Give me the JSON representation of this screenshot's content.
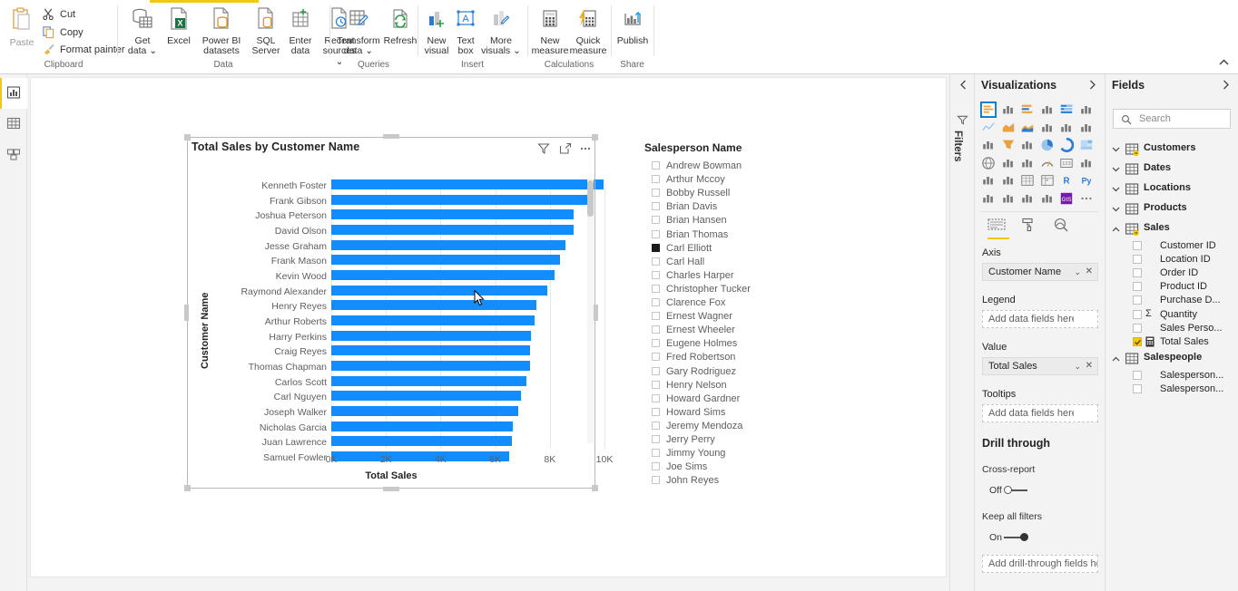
{
  "ribbon": {
    "collapse_icon": "chevron-up-icon",
    "groups": [
      {
        "name": "clipboard",
        "label": "Clipboard",
        "paste_label": "Paste",
        "commands": [
          {
            "label": "Cut",
            "icon": "scissors-icon"
          },
          {
            "label": "Copy",
            "icon": "copy-icon"
          },
          {
            "label": "Format painter",
            "icon": "paintbrush-icon"
          }
        ]
      },
      {
        "name": "data",
        "label": "Data",
        "buttons": [
          {
            "label": "Get\ndata",
            "line1": "Get",
            "line2": "data",
            "caret": true,
            "icon": "get-data-icon"
          },
          {
            "label": "Excel",
            "line1": "Excel",
            "line2": "",
            "caret": false,
            "icon": "excel-icon"
          },
          {
            "label": "Power BI datasets",
            "line1": "Power BI",
            "line2": "datasets",
            "caret": false,
            "icon": "powerbi-datasets-icon"
          },
          {
            "label": "SQL Server",
            "line1": "SQL",
            "line2": "Server",
            "caret": false,
            "icon": "sql-server-icon"
          },
          {
            "label": "Enter data",
            "line1": "Enter",
            "line2": "data",
            "caret": false,
            "icon": "enter-data-icon"
          },
          {
            "label": "Recent sources",
            "line1": "Recent",
            "line2": "sources",
            "caret": true,
            "icon": "recent-sources-icon"
          }
        ]
      },
      {
        "name": "queries",
        "label": "Queries",
        "buttons": [
          {
            "line1": "Transform",
            "line2": "data",
            "caret": true,
            "icon": "transform-data-icon"
          },
          {
            "line1": "Refresh",
            "line2": "",
            "caret": false,
            "icon": "refresh-icon"
          }
        ]
      },
      {
        "name": "insert",
        "label": "Insert",
        "buttons": [
          {
            "line1": "New",
            "line2": "visual",
            "caret": false,
            "icon": "new-visual-icon"
          },
          {
            "line1": "Text",
            "line2": "box",
            "caret": false,
            "icon": "text-box-icon"
          },
          {
            "line1": "More",
            "line2": "visuals",
            "caret": true,
            "icon": "more-visuals-icon"
          }
        ]
      },
      {
        "name": "calculations",
        "label": "Calculations",
        "buttons": [
          {
            "line1": "New",
            "line2": "measure",
            "caret": false,
            "icon": "new-measure-icon"
          },
          {
            "line1": "Quick",
            "line2": "measure",
            "caret": false,
            "icon": "quick-measure-icon"
          }
        ]
      },
      {
        "name": "share",
        "label": "Share",
        "buttons": [
          {
            "line1": "Publish",
            "line2": "",
            "caret": false,
            "icon": "publish-icon"
          }
        ]
      }
    ]
  },
  "viewbar": {
    "items": [
      {
        "name": "report-view",
        "icon": "report-view-icon",
        "selected": true
      },
      {
        "name": "data-view",
        "icon": "data-table-icon",
        "selected": false
      },
      {
        "name": "model-view",
        "icon": "model-relationships-icon",
        "selected": false
      }
    ]
  },
  "visual": {
    "title": "Total Sales by Customer Name",
    "header_icons": [
      {
        "name": "filter-funnel-icon"
      },
      {
        "name": "focus-mode-icon"
      },
      {
        "name": "more-options-icon"
      }
    ]
  },
  "chart_data": {
    "type": "bar",
    "orientation": "horizontal",
    "title": "Total Sales by Customer Name",
    "xlabel": "Total Sales",
    "ylabel": "Customer Name",
    "xlim": [
      0,
      10000
    ],
    "xticks": [
      0,
      2000,
      4000,
      6000,
      8000,
      10000
    ],
    "xtick_labels": [
      "0K",
      "2K",
      "4K",
      "6K",
      "8K",
      "10K"
    ],
    "grid": true,
    "legend": "none",
    "bar_color": "#118DFF",
    "categories": [
      "Kenneth Foster",
      "Frank Gibson",
      "Joshua Peterson",
      "David Olson",
      "Jesse Graham",
      "Frank Mason",
      "Kevin Wood",
      "Raymond Alexander",
      "Henry Reyes",
      "Arthur Roberts",
      "Harry Perkins",
      "Craig Reyes",
      "Thomas Chapman",
      "Carlos Scott",
      "Carl Nguyen",
      "Joseph Walker",
      "Nicholas Garcia",
      "Juan Lawrence",
      "Samuel Fowler"
    ],
    "values": [
      9960,
      9570,
      8860,
      8860,
      8560,
      8380,
      8180,
      7900,
      7500,
      7430,
      7310,
      7260,
      7260,
      7130,
      6960,
      6840,
      6640,
      6610,
      6510
    ]
  },
  "slicer": {
    "title": "Salesperson Name",
    "items": [
      {
        "label": "Andrew Bowman",
        "checked": false
      },
      {
        "label": "Arthur Mccoy",
        "checked": false
      },
      {
        "label": "Bobby Russell",
        "checked": false
      },
      {
        "label": "Brian Davis",
        "checked": false
      },
      {
        "label": "Brian Hansen",
        "checked": false
      },
      {
        "label": "Brian Thomas",
        "checked": false
      },
      {
        "label": "Carl Elliott",
        "checked": true
      },
      {
        "label": "Carl Hall",
        "checked": false
      },
      {
        "label": "Charles Harper",
        "checked": false
      },
      {
        "label": "Christopher Tucker",
        "checked": false
      },
      {
        "label": "Clarence Fox",
        "checked": false
      },
      {
        "label": "Ernest Wagner",
        "checked": false
      },
      {
        "label": "Ernest Wheeler",
        "checked": false
      },
      {
        "label": "Eugene Holmes",
        "checked": false
      },
      {
        "label": "Fred Robertson",
        "checked": false
      },
      {
        "label": "Gary Rodriguez",
        "checked": false
      },
      {
        "label": "Henry Nelson",
        "checked": false
      },
      {
        "label": "Howard Gardner",
        "checked": false
      },
      {
        "label": "Howard Sims",
        "checked": false
      },
      {
        "label": "Jeremy Mendoza",
        "checked": false
      },
      {
        "label": "Jerry Perry",
        "checked": false
      },
      {
        "label": "Jimmy Young",
        "checked": false
      },
      {
        "label": "Joe Sims",
        "checked": false
      },
      {
        "label": "John Reyes",
        "checked": false
      }
    ]
  },
  "filters_pane": {
    "title": "Filters",
    "chevron_icon": "chevron-left-icon",
    "funnel_icon": "filter-funnel-icon"
  },
  "visualizations": {
    "title": "Visualizations",
    "chevron_icon": "chevron-right-icon",
    "tabs": [
      {
        "name": "fields-tab",
        "icon": "fields-well-icon",
        "selected": true
      },
      {
        "name": "format-tab",
        "icon": "paint-roller-icon",
        "selected": false
      },
      {
        "name": "analytics-tab",
        "icon": "analytics-magnifier-icon",
        "selected": false
      }
    ],
    "wells": [
      {
        "label": "Axis",
        "value": "Customer Name",
        "filled": true
      },
      {
        "label": "Legend",
        "value": "Add data fields here",
        "filled": false
      },
      {
        "label": "Value",
        "value": "Total Sales",
        "filled": true
      },
      {
        "label": "Tooltips",
        "value": "Add data fields here",
        "filled": false
      }
    ],
    "drill_through": {
      "title": "Drill through",
      "cross_report_label": "Cross-report",
      "cross_report_state": "Off",
      "keep_filters_label": "Keep all filters",
      "keep_filters_state": "On",
      "drop_zone": "Add drill-through fields here"
    }
  },
  "fields": {
    "title": "Fields",
    "chevron_icon": "chevron-right-icon",
    "search_placeholder": "Search",
    "search_icon": "search-icon",
    "tables": [
      {
        "name": "Customers",
        "expanded": false,
        "icon": "table-key-icon"
      },
      {
        "name": "Dates",
        "expanded": false,
        "icon": "table-icon"
      },
      {
        "name": "Locations",
        "expanded": false,
        "icon": "table-icon"
      },
      {
        "name": "Products",
        "expanded": false,
        "icon": "table-icon"
      },
      {
        "name": "Sales",
        "expanded": true,
        "icon": "table-key-icon"
      }
    ],
    "sales_fields": [
      {
        "name": "Customer ID",
        "checked": false,
        "type": "column"
      },
      {
        "name": "Location ID",
        "checked": false,
        "type": "column"
      },
      {
        "name": "Order ID",
        "checked": false,
        "type": "column"
      },
      {
        "name": "Product ID",
        "checked": false,
        "type": "column"
      },
      {
        "name": "Purchase D...",
        "checked": false,
        "type": "column"
      },
      {
        "name": "Quantity",
        "checked": false,
        "type": "sigma"
      },
      {
        "name": "Sales Perso...",
        "checked": false,
        "type": "column"
      },
      {
        "name": "Total Sales",
        "checked": true,
        "type": "measure"
      }
    ],
    "salespeople_table": {
      "name": "Salespeople",
      "expanded": true,
      "icon": "table-icon"
    },
    "salespeople_fields": [
      {
        "name": "Salesperson...",
        "checked": false,
        "type": "column"
      },
      {
        "name": "Salesperson...",
        "checked": false,
        "type": "column"
      }
    ]
  },
  "colors": {
    "bar": "#118DFF",
    "accent": "#F2C811",
    "selected_viz": "#0078D4",
    "panel_bg": "#F3F3F3"
  }
}
